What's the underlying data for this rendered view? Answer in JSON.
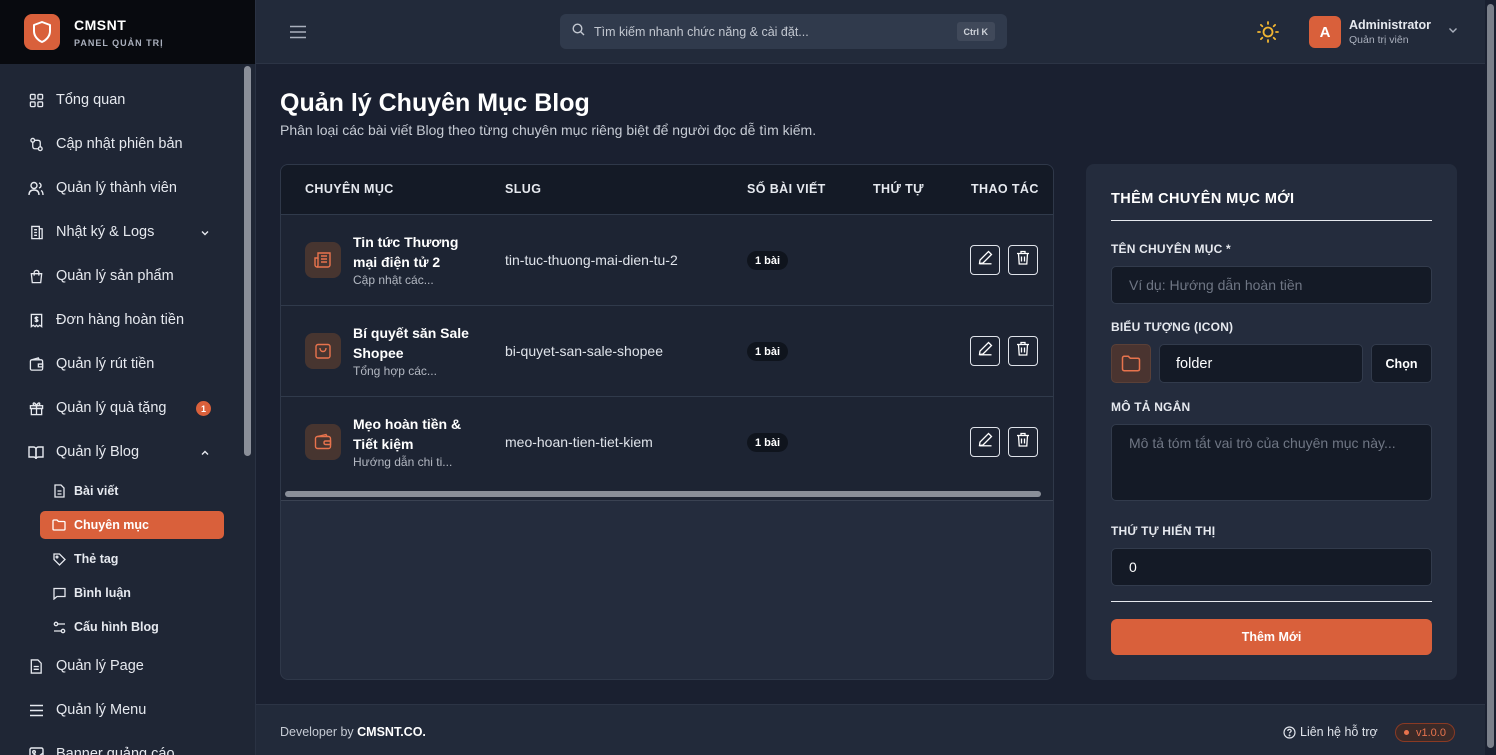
{
  "brand": {
    "name": "CMSNT",
    "subtitle": "PANEL QUẢN TRỊ"
  },
  "sidebar": {
    "items": [
      {
        "label": "Tổng quan",
        "icon": "dashboard-icon"
      },
      {
        "label": "Cập nhật phiên bản",
        "icon": "git-compare-icon"
      },
      {
        "label": "Quản lý thành viên",
        "icon": "users-icon"
      },
      {
        "label": "Nhật ký & Logs",
        "icon": "logs-icon",
        "has_children": true
      },
      {
        "label": "Quản lý sản phẩm",
        "icon": "shopping-bag-icon"
      },
      {
        "label": "Đơn hàng hoàn tiền",
        "icon": "receipt-icon"
      },
      {
        "label": "Quản lý rút tiền",
        "icon": "wallet-icon"
      },
      {
        "label": "Quản lý quà tặng",
        "icon": "gift-icon",
        "badge": "1"
      },
      {
        "label": "Quản lý Blog",
        "icon": "book-icon",
        "expanded": true
      },
      {
        "label": "Quản lý Page",
        "icon": "file-icon"
      },
      {
        "label": "Quản lý Menu",
        "icon": "menu-icon"
      },
      {
        "label": "Banner quảng cáo",
        "icon": "image-icon"
      }
    ],
    "blog_children": [
      {
        "label": "Bài viết",
        "icon": "file-text-icon"
      },
      {
        "label": "Chuyên mục",
        "icon": "folder-icon",
        "active": true
      },
      {
        "label": "Thẻ tag",
        "icon": "tag-icon"
      },
      {
        "label": "Bình luận",
        "icon": "message-icon"
      },
      {
        "label": "Cấu hình Blog",
        "icon": "settings-icon"
      }
    ]
  },
  "topbar": {
    "search_placeholder": "Tìm kiếm nhanh chức năng & cài đặt...",
    "search_shortcut": "Ctrl K",
    "user": {
      "initial": "A",
      "name": "Administrator",
      "role": "Quản trị viên"
    }
  },
  "page": {
    "title": "Quản lý Chuyên Mục Blog",
    "description": "Phân loại các bài viết Blog theo từng chuyên mục riêng biệt để người đọc dễ tìm kiếm."
  },
  "table": {
    "headers": [
      "CHUYÊN MỤC",
      "SLUG",
      "SỐ BÀI VIẾT",
      "THỨ TỰ",
      "THAO TÁC"
    ],
    "rows": [
      {
        "name": "Tin tức Thương mại điện tử 2",
        "description": "Cập nhật các...",
        "slug": "tin-tuc-thuong-mai-dien-tu-2",
        "count": "1 bài",
        "order": "",
        "icon": "newspaper-icon"
      },
      {
        "name": "Bí quyết săn Sale Shopee",
        "description": "Tổng hợp các...",
        "slug": "bi-quyet-san-sale-shopee",
        "count": "1 bài",
        "order": "",
        "icon": "shopping-bag-icon"
      },
      {
        "name": "Mẹo hoàn tiền & Tiết kiệm",
        "description": "Hướng dẫn chi ti...",
        "slug": "meo-hoan-tien-tiet-kiem",
        "count": "1 bài",
        "order": "",
        "icon": "wallet-icon"
      }
    ]
  },
  "form": {
    "title": "THÊM CHUYÊN MỤC MỚI",
    "name_label": "TÊN CHUYÊN MỤC *",
    "name_placeholder": "Ví dụ: Hướng dẫn hoàn tiền",
    "icon_label": "BIỂU TƯỢNG (ICON)",
    "icon_value": "folder",
    "choose_label": "Chọn",
    "desc_label": "MÔ TẢ NGẮN",
    "desc_placeholder": "Mô tả tóm tắt vai trò của chuyên mục này...",
    "order_label": "THỨ TỰ HIỂN THỊ",
    "order_value": "0",
    "submit_label": "Thêm Mới"
  },
  "footer": {
    "developer_prefix": "Developer by",
    "developer_name": "CMSNT.CO.",
    "support_label": "Liên hệ hỗ trợ",
    "version": "v1.0.0"
  },
  "colors": {
    "accent": "#d9603b",
    "background": "#1a2030",
    "card": "#242c3d"
  }
}
